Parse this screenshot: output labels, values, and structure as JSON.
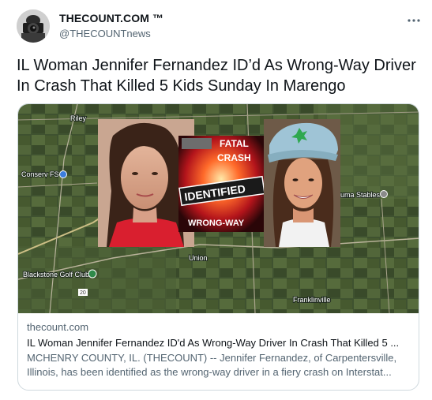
{
  "author": {
    "display_name": "THECOUNT.COM ™",
    "handle": "@THECOUNTnews",
    "avatar_icon": "avatar-photographer"
  },
  "more_icon": "more-horizontal-icon",
  "tweet": {
    "text": "IL Woman Jennifer Fernandez ID’d As Wrong-Way Driver In Crash That Killed 5 Kids Sunday In Marengo"
  },
  "card": {
    "image": {
      "map_labels": {
        "riley": "Riley",
        "conserv": "Conserv FS",
        "union": "Union",
        "blackstone": "Blackstone Golf Club",
        "franklinville": "Franklinville",
        "stables": "uma Stables",
        "road": "20"
      },
      "badge": {
        "line1": "FATAL",
        "line2": "CRASH",
        "line3": "IDENTIFIED",
        "line4": "WRONG-WAY"
      }
    },
    "domain": "thecount.com",
    "title": "IL Woman Jennifer Fernandez ID'd As Wrong-Way Driver In Crash That Killed 5 ...",
    "description_line1": "MCHENRY COUNTY, IL. (THECOUNT) -- Jennifer Fernandez, of Carpentersville,",
    "description_line2": "Illinois, has been identified as the wrong-way driver in a fiery crash on Interstat..."
  },
  "colors": {
    "text_primary": "#0f1419",
    "text_secondary": "#536471",
    "border": "#cfd9de",
    "badge_red": "#e3262b"
  }
}
